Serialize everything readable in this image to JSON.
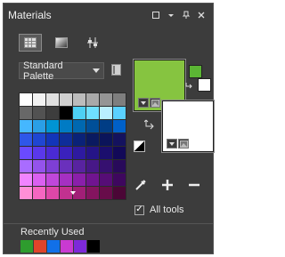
{
  "window": {
    "title": "Materials",
    "buttons": [
      "restore",
      "menu",
      "pin",
      "close"
    ]
  },
  "tabs": [
    {
      "name": "swatches",
      "active": true
    },
    {
      "name": "gradient",
      "active": false
    },
    {
      "name": "mixer",
      "active": false
    }
  ],
  "palette_dropdown": {
    "selected": "Standard Palette"
  },
  "palette": {
    "rows": [
      [
        "#ffffff",
        "#f2f2f2",
        "#e0e0e0",
        "#cfcfcf",
        "#bcbcbc",
        "#a9a9a9",
        "#959595",
        "#7e7e7e"
      ],
      [
        "#686868",
        "#525252",
        "#3d3d3d",
        "#000000",
        "#4dd0f4",
        "#6fe0ff",
        "#b9efff",
        "#5ad1ff"
      ],
      [
        "#45b7ff",
        "#2a9fe6",
        "#0094d4",
        "#007bc4",
        "#0068b0",
        "#004f98",
        "#003d85",
        "#0060c8"
      ],
      [
        "#2e57e8",
        "#1f46d2",
        "#1235b9",
        "#0e2d99",
        "#0a2278",
        "#0a1a60",
        "#0b145a",
        "#14125e"
      ],
      [
        "#6a4aff",
        "#5a38ea",
        "#4a2ad4",
        "#3a21bc",
        "#2e1aa0",
        "#251487",
        "#1b0e6d",
        "#120958"
      ],
      [
        "#a96cff",
        "#9453ec",
        "#7e3fd5",
        "#6a30bc",
        "#5823a0",
        "#471887",
        "#361070",
        "#280a5a"
      ],
      [
        "#f084ff",
        "#da60f0",
        "#c047da",
        "#a530c2",
        "#8a1faa",
        "#701490",
        "#560d76",
        "#3e075e"
      ],
      [
        "#ff8fd6",
        "#f566c1",
        "#de47a8",
        "#c23190",
        "#a11f77",
        "#84145f",
        "#680c4a",
        "#4b0636"
      ]
    ]
  },
  "colors": {
    "foreground": "#86c440",
    "background": "#ffffff",
    "mini_foreground": "#5bb534",
    "mini_background": "#ffffff"
  },
  "tools": [
    "eyedropper",
    "add",
    "remove"
  ],
  "all_tools": {
    "label": "All tools",
    "checked": true
  },
  "recently_used": {
    "label": "Recently Used",
    "swatches": [
      "#2e9c2e",
      "#e0442a",
      "#1170e8",
      "#c93ad2",
      "#7d29d9",
      "#000000"
    ]
  }
}
